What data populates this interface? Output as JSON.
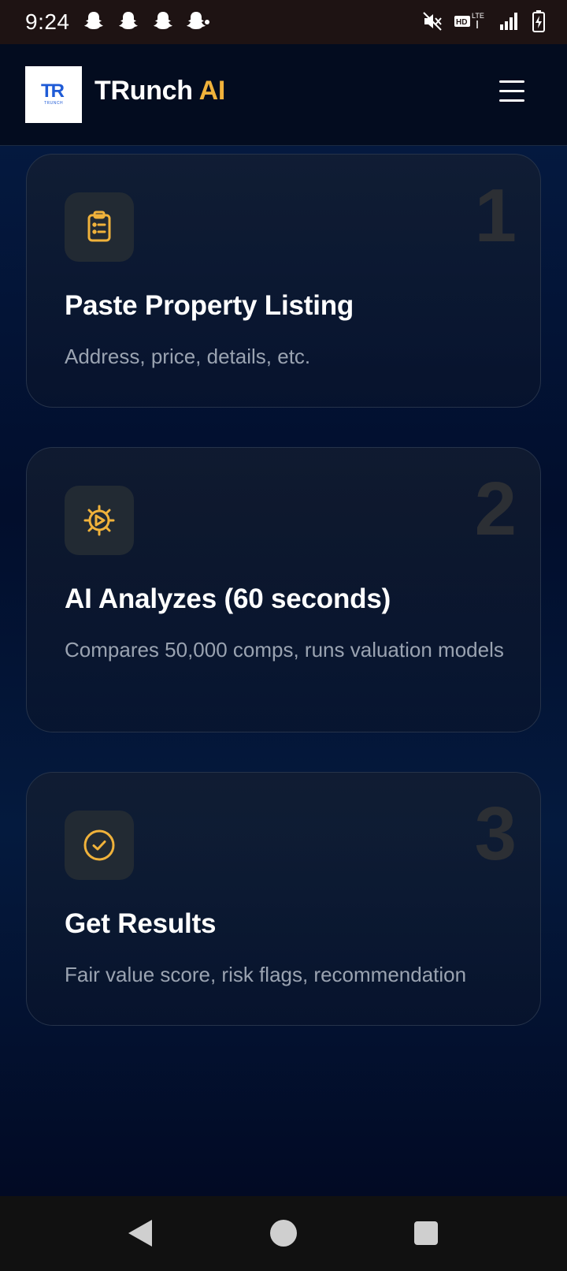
{
  "status_bar": {
    "time": "9:24",
    "left_icons": [
      "snapchat-icon",
      "snapchat-icon",
      "snapchat-icon",
      "snapchat-icon"
    ],
    "right_icons": [
      "mute-icon",
      "hd-lte-icon",
      "signal-icon",
      "battery-charging-icon"
    ]
  },
  "header": {
    "logo_mark": "TR",
    "logo_subtext": "TRUNCH",
    "brand_main": "TRunch",
    "brand_accent": "AI",
    "menu_icon": "hamburger-menu-icon"
  },
  "steps": [
    {
      "number": "1",
      "icon": "clipboard-icon",
      "title": "Paste Property Listing",
      "description": "Address, price, details, etc."
    },
    {
      "number": "2",
      "icon": "gear-icon",
      "title": "AI Analyzes (60 seconds)",
      "description": "Compares 50,000 comps, runs valuation models"
    },
    {
      "number": "3",
      "icon": "check-circle-icon",
      "title": "Get Results",
      "description": "Fair value score, risk flags, recommendation"
    }
  ],
  "nav_bar": {
    "buttons": [
      "back-icon",
      "home-icon",
      "recents-icon"
    ]
  },
  "colors": {
    "accent": "#f0b23b",
    "background": "#020a1f",
    "card_border": "#26334a",
    "muted_text": "#9aa3b1"
  }
}
